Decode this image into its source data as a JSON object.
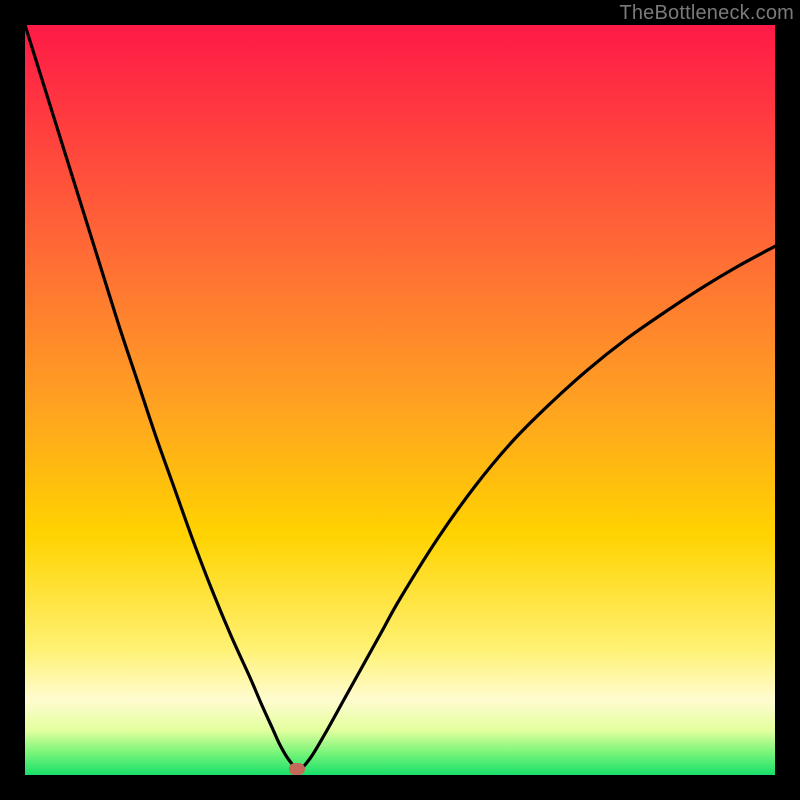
{
  "watermark": "TheBottleneck.com",
  "colors": {
    "frame": "#000000",
    "gradient_top": "#ff1a47",
    "gradient_mid": "#ffd300",
    "gradient_bottom": "#18e06a",
    "curve": "#000000",
    "marker": "#c46a5a"
  },
  "chart_data": {
    "type": "line",
    "title": "",
    "xlabel": "",
    "ylabel": "",
    "xlim": [
      0,
      100
    ],
    "ylim": [
      0,
      100
    ],
    "grid": false,
    "legend": false,
    "series": [
      {
        "name": "bottleneck-curve",
        "x": [
          0,
          2.5,
          5,
          7.5,
          10,
          12.5,
          15,
          17.5,
          20,
          22.5,
          25,
          27.5,
          30,
          31.5,
          33,
          34,
          35.2,
          36.5,
          38,
          40,
          42.5,
          45,
          47.5,
          50,
          55,
          60,
          65,
          70,
          75,
          80,
          85,
          90,
          95,
          100
        ],
        "y": [
          100,
          92,
          84,
          76,
          68,
          60,
          52.5,
          45,
          38,
          31,
          24.5,
          18.5,
          13,
          9.5,
          6.2,
          4,
          2,
          0.8,
          2.2,
          5.5,
          10,
          14.5,
          19,
          23.5,
          31.5,
          38.5,
          44.5,
          49.5,
          54,
          58,
          61.5,
          64.8,
          67.8,
          70.5
        ]
      }
    ],
    "marker": {
      "x": 36.2,
      "y": 0.8
    },
    "annotations": []
  }
}
